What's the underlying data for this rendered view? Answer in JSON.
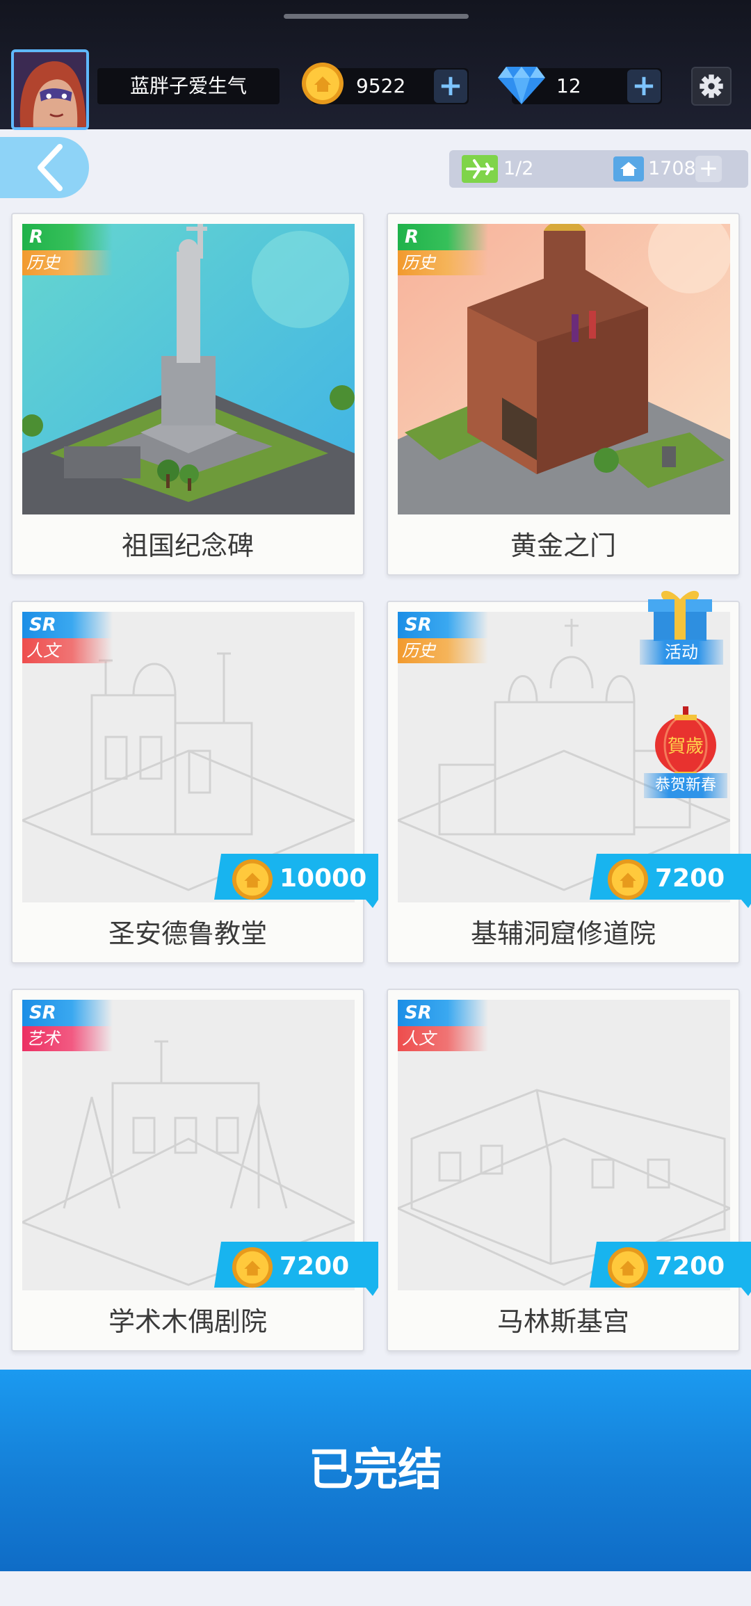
{
  "header": {
    "player_name": "蓝胖子爱生气",
    "coins": "9522",
    "gems": "12",
    "plus": "+",
    "avatar_icon": "hero-avatar",
    "coin_icon": "coin-icon",
    "gem_icon": "diamond-icon",
    "settings_icon": "gear-icon"
  },
  "subheader": {
    "flights": "1/2",
    "houses": "1708",
    "plus": "+"
  },
  "cards": [
    {
      "name": "祖国纪念碑",
      "rarity": "R",
      "category": "历史",
      "locked": false
    },
    {
      "name": "黄金之门",
      "rarity": "R",
      "category": "历史",
      "locked": false
    },
    {
      "name": "圣安德鲁教堂",
      "rarity": "SR",
      "category": "人文",
      "locked": true,
      "price": "10000"
    },
    {
      "name": "基辅洞窟修道院",
      "rarity": "SR",
      "category": "历史",
      "locked": true,
      "price": "7200"
    },
    {
      "name": "学术木偶剧院",
      "rarity": "SR",
      "category": "艺术",
      "locked": true,
      "price": "7200"
    },
    {
      "name": "马林斯基宫",
      "rarity": "SR",
      "category": "人文",
      "locked": true,
      "price": "7200"
    }
  ],
  "badges": {
    "event": "活动",
    "new_year": "恭贺新春",
    "new_year_lantern": "賀歲"
  },
  "bottom_button": "已完结",
  "colors": {
    "accent_blue": "#1b9af0",
    "rarity_r": "#1fb24a",
    "rarity_sr": "#1b8ee6",
    "cat_history": "#f29a2e",
    "cat_human": "#ee4d4d",
    "cat_art": "#ec2f62",
    "price_tag": "#18b4ef"
  }
}
